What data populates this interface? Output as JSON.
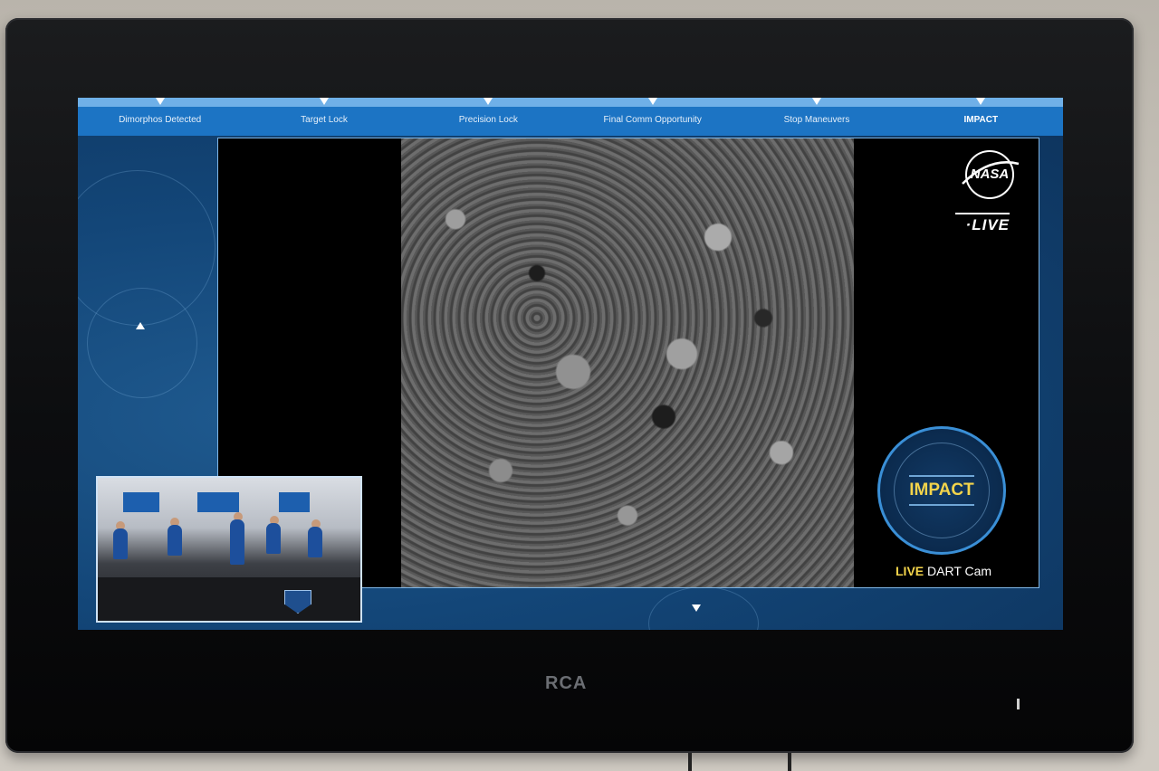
{
  "tv": {
    "brand": "RCA"
  },
  "broadcast": {
    "timeline": [
      {
        "label": "Dimorphos Detected",
        "active": false
      },
      {
        "label": "Target Lock",
        "active": false
      },
      {
        "label": "Precision Lock",
        "active": false
      },
      {
        "label": "Final Comm Opportunity",
        "active": false
      },
      {
        "label": "Stop Maneuvers",
        "active": false
      },
      {
        "label": "IMPACT",
        "active": true
      }
    ],
    "logo": "NASA",
    "live": "·LIVE",
    "impact_badge": "IMPACT",
    "cam_label_live": "LIVE",
    "cam_label_name": "DART Cam",
    "colors": {
      "accent": "#1c74c4",
      "impact_text": "#f3d44b",
      "frame_border": "#7fb6e6"
    }
  }
}
